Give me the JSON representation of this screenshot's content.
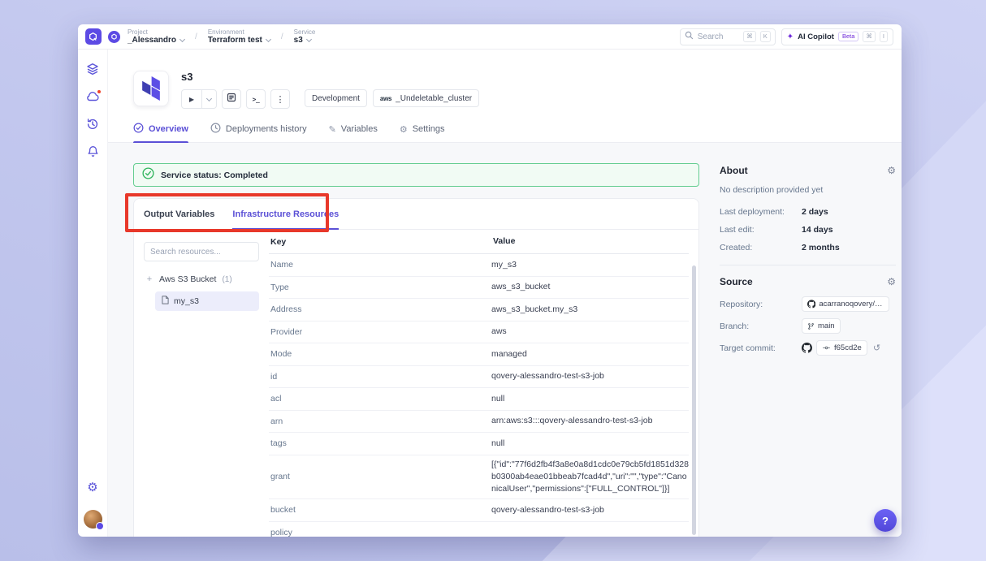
{
  "colors": {
    "accent": "#5B50D6",
    "success_border": "#63CD90",
    "annotation_red": "#E8382A"
  },
  "icons": {
    "gear": "⚙",
    "variables_glyph": "✎"
  },
  "topbar": {
    "breadcrumb": {
      "project_label": "Project",
      "project_value": "_Alessandro",
      "environment_label": "Environment",
      "environment_value": "Terraform test",
      "service_label": "Service",
      "service_value": "s3",
      "separator": "/"
    },
    "search": {
      "placeholder": "Search",
      "key1": "⌘",
      "key2": "K"
    },
    "copilot": {
      "icon": "✦",
      "label": "AI Copilot",
      "badge": "Beta",
      "key1": "⌘",
      "key2": "I"
    }
  },
  "service_header": {
    "title": "s3",
    "play_glyph": "▶",
    "terminal_glyph": ">_",
    "kebab_glyph": "⋮",
    "env_badge": "Development",
    "cluster_provider": "aws",
    "cluster_badge": "_Undeletable_cluster"
  },
  "tabs": {
    "overview": "Overview",
    "deployments": "Deployments history",
    "variables": "Variables",
    "settings": "Settings"
  },
  "status_banner": {
    "text": "Service status: Completed"
  },
  "resource_tabs": {
    "output": "Output Variables",
    "infrastructure": "Infrastructure Resources"
  },
  "resource_tree": {
    "search_placeholder": "Search resources...",
    "expand_glyph": "+",
    "group_label": "Aws S3 Bucket",
    "group_count": "(1)",
    "item": "my_s3"
  },
  "resource_table": {
    "col_key": "Key",
    "col_value": "Value",
    "rows": [
      {
        "key": "Name",
        "value": "my_s3"
      },
      {
        "key": "Type",
        "value": "aws_s3_bucket"
      },
      {
        "key": "Address",
        "value": "aws_s3_bucket.my_s3"
      },
      {
        "key": "Provider",
        "value": "aws"
      },
      {
        "key": "Mode",
        "value": "managed"
      },
      {
        "key": "id",
        "value": "qovery-alessandro-test-s3-job"
      },
      {
        "key": "acl",
        "value": "null"
      },
      {
        "key": "arn",
        "value": "arn:aws:s3:::qovery-alessandro-test-s3-job"
      },
      {
        "key": "tags",
        "value": "null"
      },
      {
        "key": "grant",
        "value": "[{\"id\":\"77f6d2fb4f3a8e0a8d1cdc0e79cb5fd1851d328b0300ab4eae01bbeab7fcad4d\",\"uri\":\"\",\"type\":\"CanonicalUser\",\"permissions\":[\"FULL_CONTROL\"]}]"
      },
      {
        "key": "bucket",
        "value": "qovery-alessandro-test-s3-job"
      },
      {
        "key": "policy",
        "value": ""
      }
    ]
  },
  "about": {
    "title": "About",
    "description": "No description provided yet",
    "last_deployment_label": "Last deployment:",
    "last_deployment_value": "2 days",
    "last_edit_label": "Last edit:",
    "last_edit_value": "14 days",
    "created_label": "Created:",
    "created_value": "2 months"
  },
  "source": {
    "title": "Source",
    "repository_label": "Repository:",
    "repository_value": "acarranoqovery/te...",
    "branch_label": "Branch:",
    "branch_value": "main",
    "commit_label": "Target commit:",
    "commit_value": "f65cd2e",
    "reset_glyph": "↺"
  },
  "help": {
    "label": "?"
  }
}
